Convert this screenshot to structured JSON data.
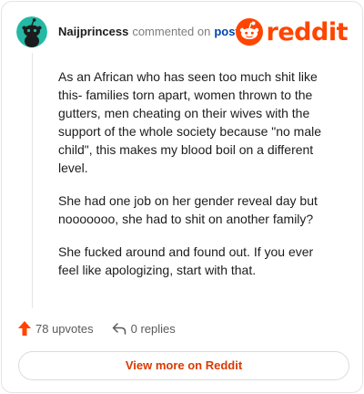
{
  "header": {
    "username": "Naijprincess",
    "action_text": "commented on",
    "post_link": "post",
    "logo_text": "reddit",
    "avatar_icon": "snoo-avatar-icon",
    "logo_icon": "reddit-alien-icon"
  },
  "comment": {
    "paragraphs": [
      "As an African who has seen too much shit like this- families torn apart, women thrown to the gutters, men cheating on their wives with the support of the whole society because \"no male child\", this makes my blood boil on a different level.",
      "She had one job on her gender reveal day but nooooooo, she had to shit on another family?",
      "She fucked around and found out. If you ever feel like apologizing, start with that."
    ]
  },
  "footer": {
    "upvotes": "78 upvotes",
    "replies": "0 replies",
    "upvote_icon": "upvote-arrow-icon",
    "reply_icon": "reply-icon"
  },
  "cta": {
    "label": "View more on Reddit"
  },
  "colors": {
    "accent": "#ff4500",
    "avatar_bg": "#24b9a4",
    "link": "#0045ac",
    "cta_text": "#d93a00"
  }
}
